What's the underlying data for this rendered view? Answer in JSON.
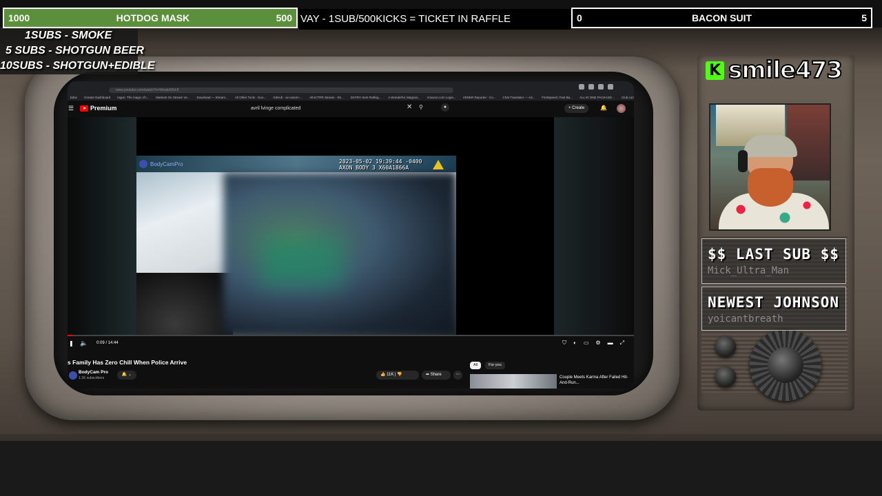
{
  "goals": {
    "left": {
      "count": "1000",
      "title": "HOTDOG MASK",
      "target": "500"
    },
    "right": {
      "count": "0",
      "title": "BACON SUIT",
      "target": "5"
    },
    "ticker": "VAY - 1SUB/500KICKS = TICKET IN RAFFLE",
    "colors": {
      "left_bg": "#5c8f3c",
      "right_bg": "#000000"
    }
  },
  "sub_goals": [
    "1SUBS   - SMOKE",
    "5 SUBS  - SHOTGUN BEER",
    "10SUBS - SHOTGUN+EDIBLE"
  ],
  "streamer": {
    "platform_icon": "kick-logo-icon",
    "name": "smile473"
  },
  "alerts": {
    "last_sub_title": "$$ LAST SUB $$",
    "last_sub_name": "Mick_Ultra_Man",
    "newest_title": "NEWEST JOHNSON",
    "newest_name": "yoicantbreath"
  },
  "browser": {
    "address": "www.youtube.com/watch?v=Wmde5Rd-8",
    "bookmarks": [
      "bdne",
      "Creator Dashboard",
      "Ingun: The magic of t...",
      "Markets On Stream Ve...",
      "Download — Stream...",
      "All Other Tools - Goo...",
      "GitHub - ai-custom-...",
      "AfroCTRR Stream - Kb...",
      "DSTRV Sent Rolling...",
      "A Wonderful, Magical...",
      "Amazon.com Login...",
      "VENKR Reporter - Co...",
      "Chat Translator — Ad...",
      "FirstSpeed | Fast Ba...",
      "ALL IN ONE PACKAGE...",
      "Club.com"
    ]
  },
  "youtube": {
    "logo": "Premium",
    "search_query": "avril lvinge complicated",
    "create_label": "Create",
    "bell_count": "9+",
    "watermark": "BodyCamPro",
    "timestamp_line1": "2023-05-02 19:39:44 -0400",
    "timestamp_line2": "AXON BODY 3 X60A1866A",
    "time": "0:09 / 14:44",
    "progress": 0.0102,
    "video_title": "s Family Has Zero Chill When Police Arrive",
    "channel_name": "BodyCam Pro",
    "channel_subs": "1.1K subscribers",
    "likes": "11K",
    "share_label": "Share",
    "chips": [
      "All",
      "For you"
    ],
    "rec_title": "Couple Meets Karma After Failed Hit-And-Run..."
  }
}
